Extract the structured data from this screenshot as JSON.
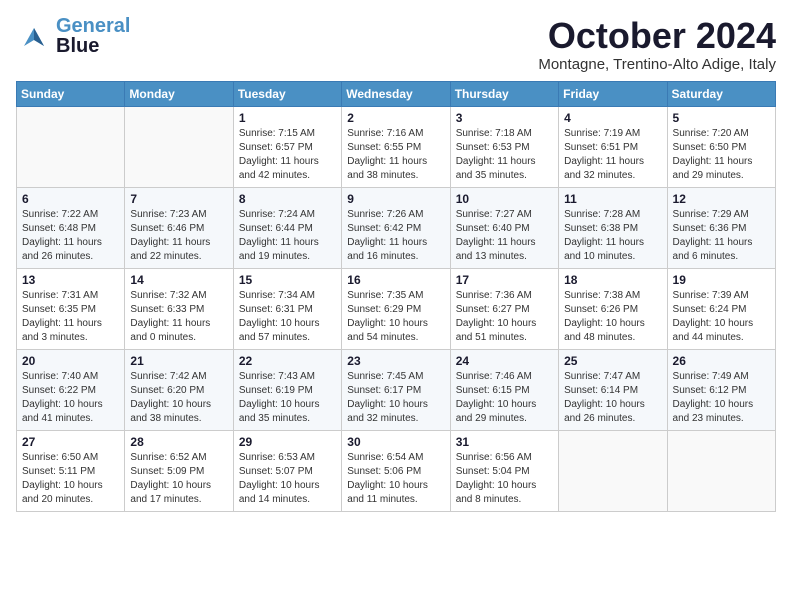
{
  "header": {
    "logo_line1": "General",
    "logo_line2": "Blue",
    "month": "October 2024",
    "location": "Montagne, Trentino-Alto Adige, Italy"
  },
  "weekdays": [
    "Sunday",
    "Monday",
    "Tuesday",
    "Wednesday",
    "Thursday",
    "Friday",
    "Saturday"
  ],
  "weeks": [
    [
      {
        "day": "",
        "info": ""
      },
      {
        "day": "",
        "info": ""
      },
      {
        "day": "1",
        "info": "Sunrise: 7:15 AM\nSunset: 6:57 PM\nDaylight: 11 hours and 42 minutes."
      },
      {
        "day": "2",
        "info": "Sunrise: 7:16 AM\nSunset: 6:55 PM\nDaylight: 11 hours and 38 minutes."
      },
      {
        "day": "3",
        "info": "Sunrise: 7:18 AM\nSunset: 6:53 PM\nDaylight: 11 hours and 35 minutes."
      },
      {
        "day": "4",
        "info": "Sunrise: 7:19 AM\nSunset: 6:51 PM\nDaylight: 11 hours and 32 minutes."
      },
      {
        "day": "5",
        "info": "Sunrise: 7:20 AM\nSunset: 6:50 PM\nDaylight: 11 hours and 29 minutes."
      }
    ],
    [
      {
        "day": "6",
        "info": "Sunrise: 7:22 AM\nSunset: 6:48 PM\nDaylight: 11 hours and 26 minutes."
      },
      {
        "day": "7",
        "info": "Sunrise: 7:23 AM\nSunset: 6:46 PM\nDaylight: 11 hours and 22 minutes."
      },
      {
        "day": "8",
        "info": "Sunrise: 7:24 AM\nSunset: 6:44 PM\nDaylight: 11 hours and 19 minutes."
      },
      {
        "day": "9",
        "info": "Sunrise: 7:26 AM\nSunset: 6:42 PM\nDaylight: 11 hours and 16 minutes."
      },
      {
        "day": "10",
        "info": "Sunrise: 7:27 AM\nSunset: 6:40 PM\nDaylight: 11 hours and 13 minutes."
      },
      {
        "day": "11",
        "info": "Sunrise: 7:28 AM\nSunset: 6:38 PM\nDaylight: 11 hours and 10 minutes."
      },
      {
        "day": "12",
        "info": "Sunrise: 7:29 AM\nSunset: 6:36 PM\nDaylight: 11 hours and 6 minutes."
      }
    ],
    [
      {
        "day": "13",
        "info": "Sunrise: 7:31 AM\nSunset: 6:35 PM\nDaylight: 11 hours and 3 minutes."
      },
      {
        "day": "14",
        "info": "Sunrise: 7:32 AM\nSunset: 6:33 PM\nDaylight: 11 hours and 0 minutes."
      },
      {
        "day": "15",
        "info": "Sunrise: 7:34 AM\nSunset: 6:31 PM\nDaylight: 10 hours and 57 minutes."
      },
      {
        "day": "16",
        "info": "Sunrise: 7:35 AM\nSunset: 6:29 PM\nDaylight: 10 hours and 54 minutes."
      },
      {
        "day": "17",
        "info": "Sunrise: 7:36 AM\nSunset: 6:27 PM\nDaylight: 10 hours and 51 minutes."
      },
      {
        "day": "18",
        "info": "Sunrise: 7:38 AM\nSunset: 6:26 PM\nDaylight: 10 hours and 48 minutes."
      },
      {
        "day": "19",
        "info": "Sunrise: 7:39 AM\nSunset: 6:24 PM\nDaylight: 10 hours and 44 minutes."
      }
    ],
    [
      {
        "day": "20",
        "info": "Sunrise: 7:40 AM\nSunset: 6:22 PM\nDaylight: 10 hours and 41 minutes."
      },
      {
        "day": "21",
        "info": "Sunrise: 7:42 AM\nSunset: 6:20 PM\nDaylight: 10 hours and 38 minutes."
      },
      {
        "day": "22",
        "info": "Sunrise: 7:43 AM\nSunset: 6:19 PM\nDaylight: 10 hours and 35 minutes."
      },
      {
        "day": "23",
        "info": "Sunrise: 7:45 AM\nSunset: 6:17 PM\nDaylight: 10 hours and 32 minutes."
      },
      {
        "day": "24",
        "info": "Sunrise: 7:46 AM\nSunset: 6:15 PM\nDaylight: 10 hours and 29 minutes."
      },
      {
        "day": "25",
        "info": "Sunrise: 7:47 AM\nSunset: 6:14 PM\nDaylight: 10 hours and 26 minutes."
      },
      {
        "day": "26",
        "info": "Sunrise: 7:49 AM\nSunset: 6:12 PM\nDaylight: 10 hours and 23 minutes."
      }
    ],
    [
      {
        "day": "27",
        "info": "Sunrise: 6:50 AM\nSunset: 5:11 PM\nDaylight: 10 hours and 20 minutes."
      },
      {
        "day": "28",
        "info": "Sunrise: 6:52 AM\nSunset: 5:09 PM\nDaylight: 10 hours and 17 minutes."
      },
      {
        "day": "29",
        "info": "Sunrise: 6:53 AM\nSunset: 5:07 PM\nDaylight: 10 hours and 14 minutes."
      },
      {
        "day": "30",
        "info": "Sunrise: 6:54 AM\nSunset: 5:06 PM\nDaylight: 10 hours and 11 minutes."
      },
      {
        "day": "31",
        "info": "Sunrise: 6:56 AM\nSunset: 5:04 PM\nDaylight: 10 hours and 8 minutes."
      },
      {
        "day": "",
        "info": ""
      },
      {
        "day": "",
        "info": ""
      }
    ]
  ]
}
